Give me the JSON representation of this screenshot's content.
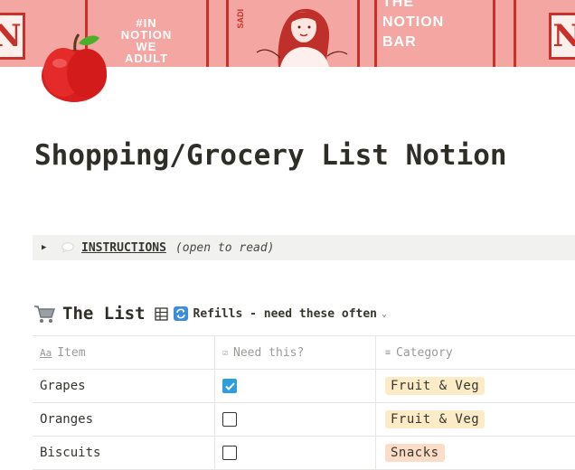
{
  "cover": {
    "stack_a": [
      "#IN",
      "NOTION",
      "WE",
      "ADULT"
    ],
    "stack_b": [
      "THE",
      "NOTION",
      "BAR"
    ],
    "side_text": "SADI",
    "logo_letter": "N"
  },
  "page": {
    "icon": "red-apple-icon",
    "title": "Shopping/Grocery List Notion"
  },
  "toggle": {
    "label": "INSTRUCTIONS",
    "hint": "(open to read)"
  },
  "database": {
    "icon": "shopping-cart-icon",
    "title": "The List",
    "view_icon": "table-icon",
    "view_emoji": "refresh-icon",
    "view_name": "Refills - need these often",
    "columns": [
      {
        "icon": "Aa",
        "label": "Item"
      },
      {
        "icon": "checkbox-icon",
        "label": "Need this?"
      },
      {
        "icon": "list-icon",
        "label": "Category"
      }
    ],
    "rows": [
      {
        "item": "Grapes",
        "need": true,
        "category": "Fruit & Veg"
      },
      {
        "item": "Oranges",
        "need": false,
        "category": "Fruit & Veg"
      },
      {
        "item": "Biscuits",
        "need": false,
        "category": "Snacks"
      }
    ]
  },
  "colors": {
    "cover_bg": "#f3a6a2",
    "cover_accent": "#c9302a",
    "tag_fruit_veg": "#fbecc7",
    "tag_snacks": "#fbdcc7",
    "checkbox_checked": "#2e9ee0",
    "toggle_bg": "#f1f1ef"
  }
}
